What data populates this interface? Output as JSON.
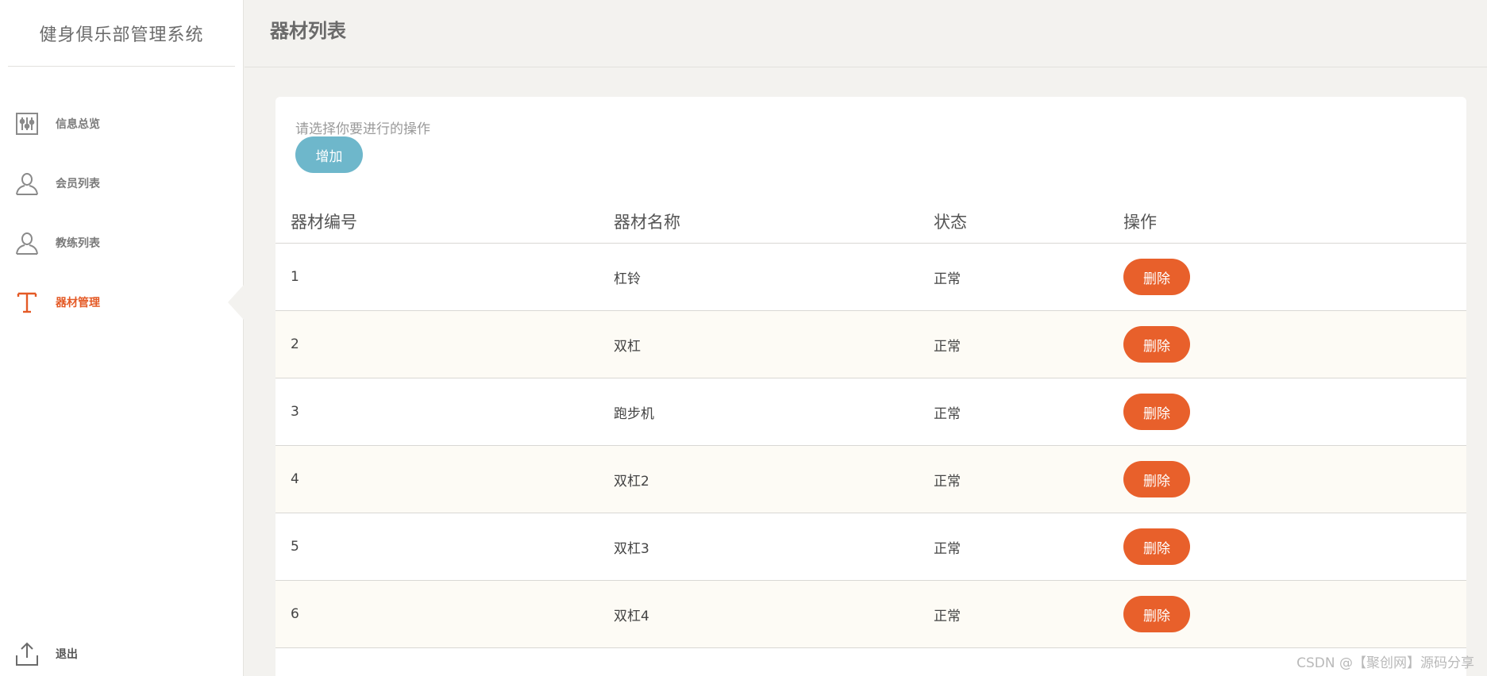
{
  "app": {
    "title": "健身俱乐部管理系统"
  },
  "sidebar": {
    "items": [
      {
        "label": "信息总览",
        "icon": "sliders-icon",
        "active": false
      },
      {
        "label": "会员列表",
        "icon": "user-icon",
        "active": false
      },
      {
        "label": "教练列表",
        "icon": "user-icon",
        "active": false
      },
      {
        "label": "器材管理",
        "icon": "text-icon",
        "active": true
      }
    ],
    "logout": {
      "label": "退出",
      "icon": "upload-icon"
    }
  },
  "page": {
    "title": "器材列表"
  },
  "toolbar": {
    "hint": "请选择你要进行的操作",
    "add_label": "增加"
  },
  "table": {
    "headers": [
      "器材编号",
      "器材名称",
      "状态",
      "操作"
    ],
    "rows": [
      {
        "id": "1",
        "name": "杠铃",
        "status": "正常",
        "action": "删除"
      },
      {
        "id": "2",
        "name": "双杠",
        "status": "正常",
        "action": "删除"
      },
      {
        "id": "3",
        "name": "跑步机",
        "status": "正常",
        "action": "删除"
      },
      {
        "id": "4",
        "name": "双杠2",
        "status": "正常",
        "action": "删除"
      },
      {
        "id": "5",
        "name": "双杠3",
        "status": "正常",
        "action": "删除"
      },
      {
        "id": "6",
        "name": "双杠4",
        "status": "正常",
        "action": "删除"
      }
    ]
  },
  "watermark": "CSDN @【聚创网】源码分享",
  "colors": {
    "accent": "#e45a26",
    "delete_button": "#e8602b",
    "add_button": "#6eb7cb",
    "page_bg": "#f3f2ef",
    "alt_row_bg": "#fdfbf5"
  }
}
